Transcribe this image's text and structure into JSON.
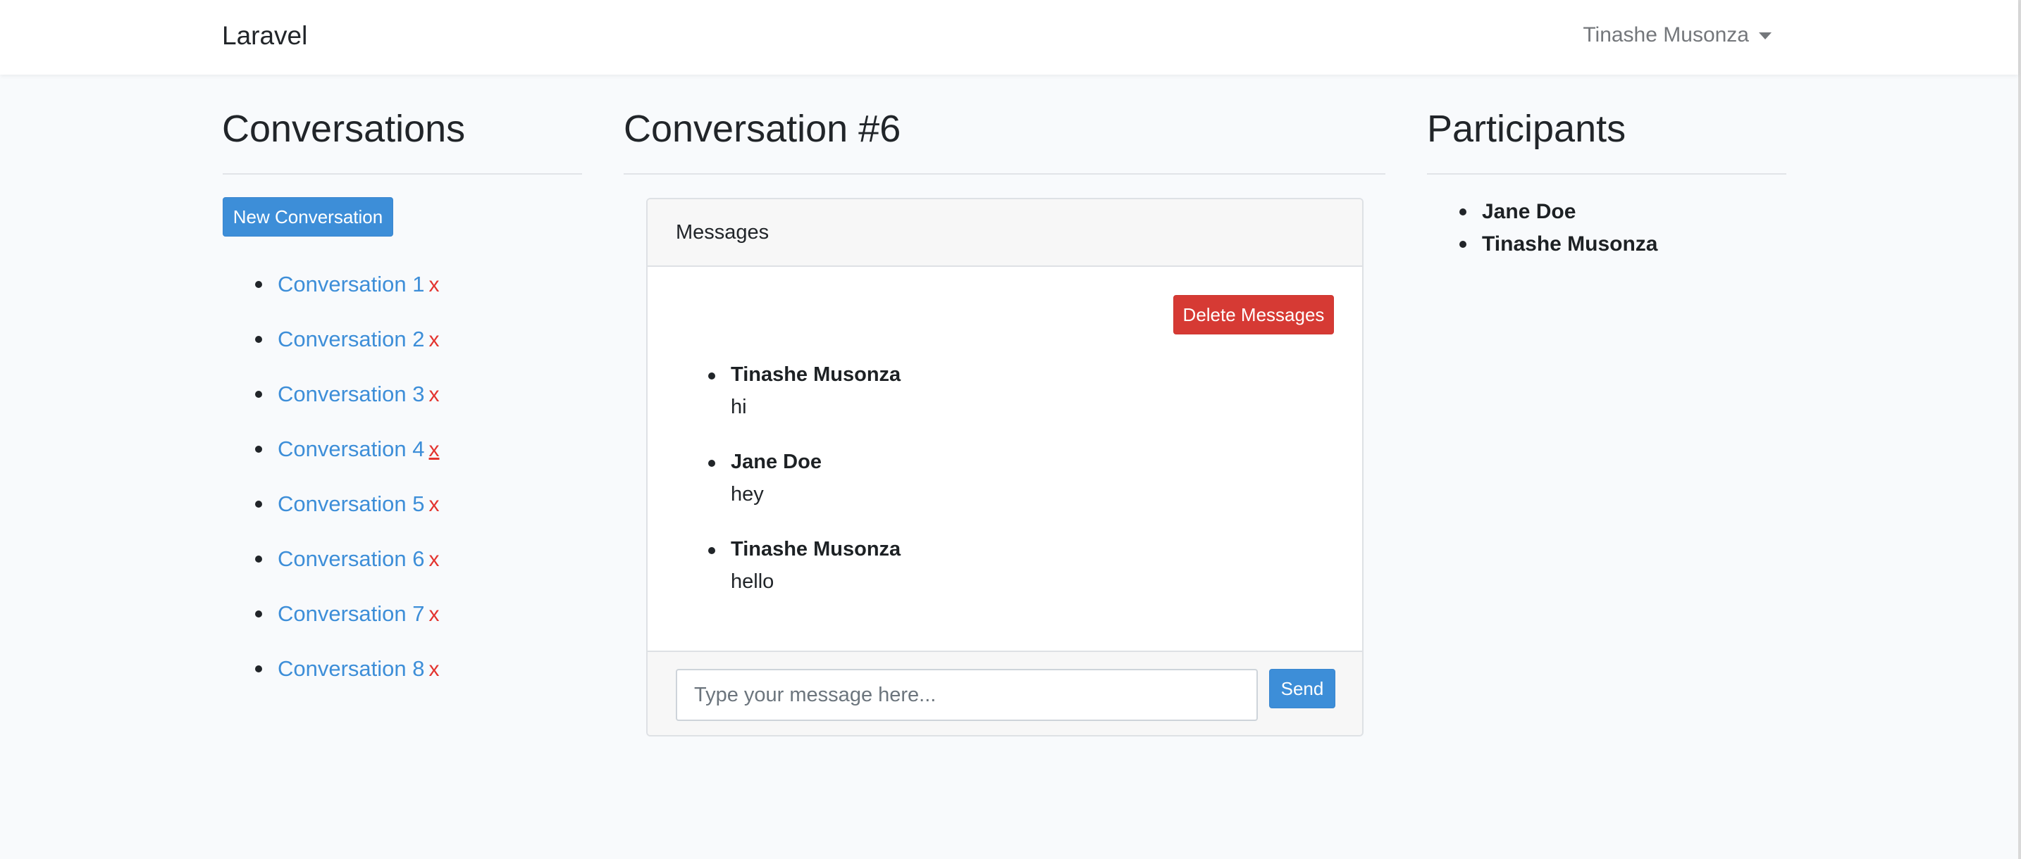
{
  "navbar": {
    "brand": "Laravel",
    "user_name": "Tinashe Musonza"
  },
  "conversations": {
    "title": "Conversations",
    "new_button": "New Conversation",
    "delete_glyph": "x",
    "items": [
      {
        "label": "Conversation 1"
      },
      {
        "label": "Conversation 2"
      },
      {
        "label": "Conversation 3"
      },
      {
        "label": "Conversation 4"
      },
      {
        "label": "Conversation 5"
      },
      {
        "label": "Conversation 6"
      },
      {
        "label": "Conversation 7"
      },
      {
        "label": "Conversation 8"
      }
    ]
  },
  "conversation": {
    "title": "Conversation #6",
    "card_header": "Messages",
    "delete_button": "Delete Messages",
    "messages": [
      {
        "author": "Tinashe Musonza",
        "body": "hi"
      },
      {
        "author": "Jane Doe",
        "body": "hey"
      },
      {
        "author": "Tinashe Musonza",
        "body": "hello"
      }
    ],
    "input_placeholder": "Type your message here...",
    "input_value": "",
    "send_button": "Send"
  },
  "participants": {
    "title": "Participants",
    "items": [
      {
        "name": "Jane Doe"
      },
      {
        "name": "Tinashe Musonza"
      }
    ]
  },
  "colors": {
    "primary": "#3d8ed8",
    "danger": "#d63a34",
    "delete_x": "#e3342f",
    "background": "#f8fafc"
  }
}
